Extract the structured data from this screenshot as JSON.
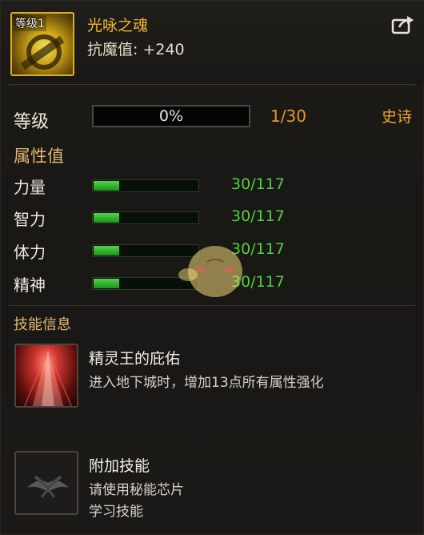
{
  "item": {
    "level_badge": "等级1",
    "name": "光咏之魂",
    "stat": "抗魔值: +240"
  },
  "level": {
    "label": "等级",
    "progress_text": "0%",
    "progress": 0,
    "count": "1/30",
    "rarity": "史诗"
  },
  "attributes": {
    "title": "属性值",
    "items": [
      {
        "name": "力量",
        "value": "30/117",
        "fill": 0.26
      },
      {
        "name": "智力",
        "value": "30/117",
        "fill": 0.26
      },
      {
        "name": "体力",
        "value": "30/117",
        "fill": 0.26
      },
      {
        "name": "精神",
        "value": "30/117",
        "fill": 0.26
      }
    ]
  },
  "skills": {
    "title": "技能信息",
    "items": [
      {
        "name": "精灵王的庇佑",
        "desc": [
          "进入地下城时，增加13点所有属性强化"
        ]
      },
      {
        "name": "附加技能",
        "desc": [
          "请使用秘能芯片",
          "学习技能"
        ]
      }
    ]
  },
  "colors": {
    "name_gold": "#f0b62a",
    "rarity_orange": "#e9a52b",
    "attr_green": "#4fd03e",
    "count_orange": "#e59a22",
    "section_tan": "#e2b76f"
  },
  "icons": {
    "share": "share-external-icon",
    "item": "golden-soul-emblem-icon",
    "skill1": "red-light-beam-icon",
    "skill2": "locked-emblem-icon"
  }
}
